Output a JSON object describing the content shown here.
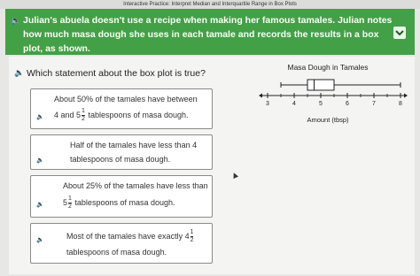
{
  "window_title": "Interactive Practice: Interpret Median and Interquartile Range in Box Plots",
  "question": "Julian's abuela doesn't use a recipe when making her famous tamales. Julian notes how much masa dough she uses in each tamale and records the results in a box plot, as shown.",
  "prompt": "Which statement about the box plot is true?",
  "choices": [
    {
      "line1": "About 50% of the tamales have between",
      "line2_pre": "4 and 5",
      "frac_n": "1",
      "frac_d": "2",
      "line2_post": " tablespoons of masa dough."
    },
    {
      "line1": "Half of the tamales have less than 4",
      "line2_pre": "tablespoons of masa dough.",
      "frac_n": "",
      "frac_d": "",
      "line2_post": ""
    },
    {
      "line1": "About 25% of the tamales have less than",
      "line2_pre": "5",
      "frac_n": "1",
      "frac_d": "2",
      "line2_post": " tablespoons of masa dough."
    },
    {
      "line1": "Most of the tamales have exactly 4",
      "line1_frac_n": "1",
      "line1_frac_d": "2",
      "line2_pre": "tablespoons of masa dough.",
      "frac_n": "",
      "frac_d": "",
      "line2_post": ""
    }
  ],
  "chart_data": {
    "type": "box",
    "title": "Masa Dough in Tamales",
    "xlabel": "Amount (tbsp)",
    "ticks": [
      "3",
      "4",
      "5",
      "6",
      "7",
      "8"
    ],
    "axis_range": [
      3,
      8
    ],
    "box": {
      "min": 3.5,
      "q1": 4.5,
      "median": 4.75,
      "q3": 5.5,
      "max": 8
    }
  },
  "colors": {
    "banner": "#43a047",
    "box_stroke": "#222222"
  },
  "icons": {
    "audio": "speaker-icon",
    "expand": "chevron-down-icon"
  }
}
